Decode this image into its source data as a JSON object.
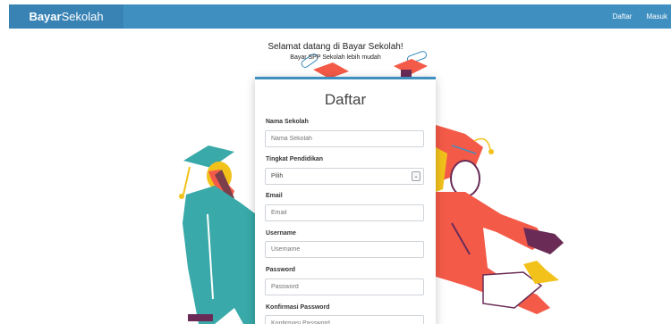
{
  "navbar": {
    "brand_bold": "Bayar",
    "brand_rest": "Sekolah",
    "links": [
      "Daftar",
      "Masuk"
    ]
  },
  "welcome": {
    "title": "Selamat datang di Bayar Sekolah!",
    "subtitle": "Bayar SPP Sekolah lebih mudah"
  },
  "form": {
    "title": "Daftar",
    "fields": [
      {
        "label": "Nama Sekolah",
        "placeholder": "Nama Sekolah"
      },
      {
        "label": "Tingkat Pendidikan",
        "value": "Pilih"
      },
      {
        "label": "Email",
        "placeholder": "Email"
      },
      {
        "label": "Username",
        "placeholder": "Username"
      },
      {
        "label": "Password",
        "placeholder": "Password"
      },
      {
        "label": "Konfirmasi Password",
        "placeholder": "Konfirmasi Password"
      }
    ]
  },
  "colors": {
    "primary": "#3f8fc1",
    "brand_bg": "#3882b4",
    "teal": "#3aa9a9",
    "coral": "#f45a48",
    "purple": "#6a2c57",
    "yellow": "#f2c21b"
  }
}
